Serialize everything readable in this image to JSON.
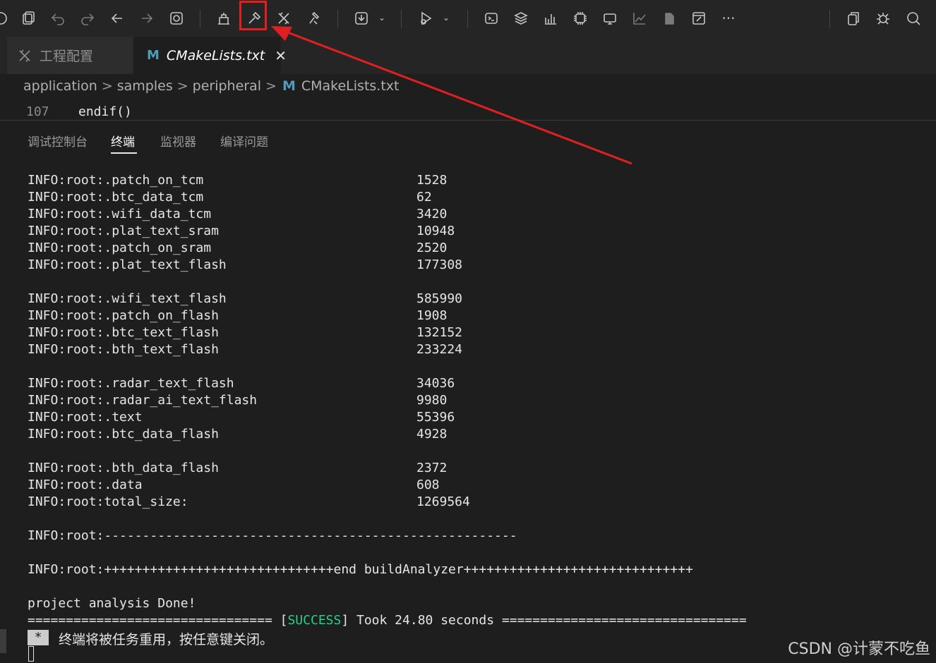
{
  "toolbar": {
    "icons": [
      "copy-paste-icon",
      "undo-icon",
      "redo-icon",
      "back-icon",
      "forward-icon",
      "find-file-icon",
      "clean-icon",
      "build-icon",
      "rebuild-icon",
      "clean-build-icon",
      "download-icon",
      "debug-run-icon",
      "terminal-icon",
      "layers-icon",
      "chart-icon",
      "chip-icon",
      "monitor-icon",
      "graph-icon",
      "files-icon",
      "window-icon",
      "more-icon",
      "explorer-icon",
      "extension-icon",
      "search-icon"
    ],
    "more_label": "···"
  },
  "tabs": [
    {
      "label": "工程配置",
      "icon": "tools-icon",
      "active": false
    },
    {
      "label": "CMakeLists.txt",
      "icon": "m-icon",
      "icon_text": "M",
      "active": true,
      "close": "✕"
    }
  ],
  "breadcrumbs": {
    "items": [
      "application",
      "samples",
      "peripheral"
    ],
    "file_icon": "M",
    "file": "CMakeLists.txt",
    "separator": ">"
  },
  "editor": {
    "line_number": "107",
    "code": "endif()"
  },
  "panel_tabs": [
    "调试控制台",
    "终端",
    "监视器",
    "编译问题"
  ],
  "terminal": {
    "rows": [
      {
        "label": "INFO:root:.patch_on_tcm",
        "value": "1528"
      },
      {
        "label": "INFO:root:.btc_data_tcm",
        "value": "62"
      },
      {
        "label": "INFO:root:.wifi_data_tcm",
        "value": "3420"
      },
      {
        "label": "INFO:root:.plat_text_sram",
        "value": "10948"
      },
      {
        "label": "INFO:root:.patch_on_sram",
        "value": "2520"
      },
      {
        "label": "INFO:root:.plat_text_flash",
        "value": "177308"
      },
      {
        "label": "",
        "value": ""
      },
      {
        "label": "INFO:root:.wifi_text_flash",
        "value": "585990"
      },
      {
        "label": "INFO:root:.patch_on_flash",
        "value": "1908"
      },
      {
        "label": "INFO:root:.btc_text_flash",
        "value": "132152"
      },
      {
        "label": "INFO:root:.bth_text_flash",
        "value": "233224"
      },
      {
        "label": "",
        "value": ""
      },
      {
        "label": "INFO:root:.radar_text_flash",
        "value": "34036"
      },
      {
        "label": "INFO:root:.radar_ai_text_flash",
        "value": "9980"
      },
      {
        "label": "INFO:root:.text",
        "value": "55396"
      },
      {
        "label": "INFO:root:.btc_data_flash",
        "value": "4928"
      },
      {
        "label": "",
        "value": ""
      },
      {
        "label": "INFO:root:.bth_data_flash",
        "value": "2372"
      },
      {
        "label": "INFO:root:.data",
        "value": "608"
      },
      {
        "label": "INFO:root:total_size:",
        "value": "1269564"
      }
    ],
    "separator_line": "INFO:root:------------------------------------------------------",
    "end_line": "INFO:root:++++++++++++++++++++++++++++++end buildAnalyzer++++++++++++++++++++++++++++++",
    "done_line": "project analysis Done!",
    "result_prefix": "================================ [",
    "result_status": "SUCCESS",
    "result_suffix": "] Took 24.80 seconds ================================",
    "cursor_char": "*",
    "notice": "终端将被任务重用，按任意键关闭。"
  },
  "watermark": "CSDN @计蒙不吃鱼",
  "colors": {
    "highlight": "#e02020",
    "success": "#23d18b",
    "m_icon": "#519aba"
  }
}
